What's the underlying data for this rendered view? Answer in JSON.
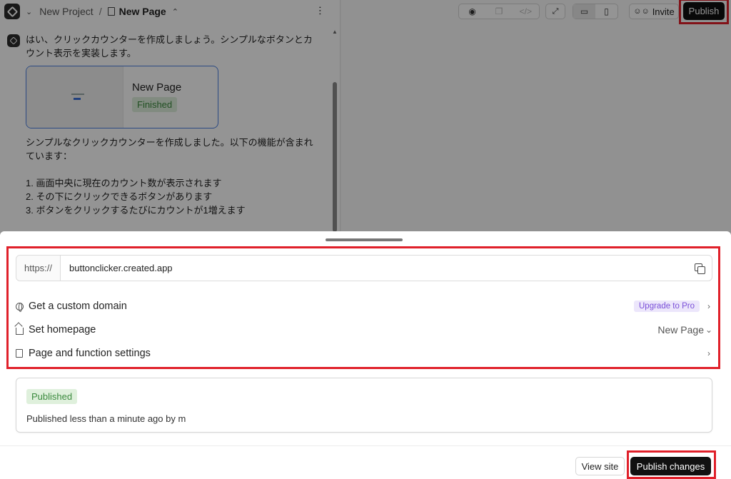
{
  "header": {
    "project": "New Project",
    "separator": "/",
    "page": "New Page"
  },
  "chat": {
    "message1": "はい、クリックカウンターを作成しましょう。シンプルなボタンとカウント表示を実装します。",
    "card": {
      "title": "New Page",
      "status": "Finished"
    },
    "message2": "シンプルなクリックカウンターを作成しました。以下の機能が含まれています：",
    "items": [
      "1. 画面中央に現在のカウント数が表示されます",
      "2. その下にクリックできるボタンがあります",
      "3. ボタンをクリックするたびにカウントが1増えます"
    ]
  },
  "toolbar": {
    "invite_label": "Invite",
    "publish_label": "Publish"
  },
  "publish_sheet": {
    "url_protocol": "https://",
    "url": "buttonclicker.created.app",
    "rows": [
      {
        "label": "Get a custom domain",
        "badge": "Upgrade to Pro",
        "icon": "globe-icon"
      },
      {
        "label": "Set homepage",
        "value": "New Page",
        "icon": "home-icon"
      },
      {
        "label": "Page and function settings",
        "icon": "page-icon"
      }
    ],
    "status_badge": "Published",
    "status_text": "Published less than a minute ago by m",
    "view_site_label": "View site",
    "publish_changes_label": "Publish changes"
  },
  "colors": {
    "highlight": "#e0202a",
    "primary_button": "#111111",
    "published_badge_bg": "#dff0dc",
    "pro_badge_fg": "#7a4fd8"
  }
}
